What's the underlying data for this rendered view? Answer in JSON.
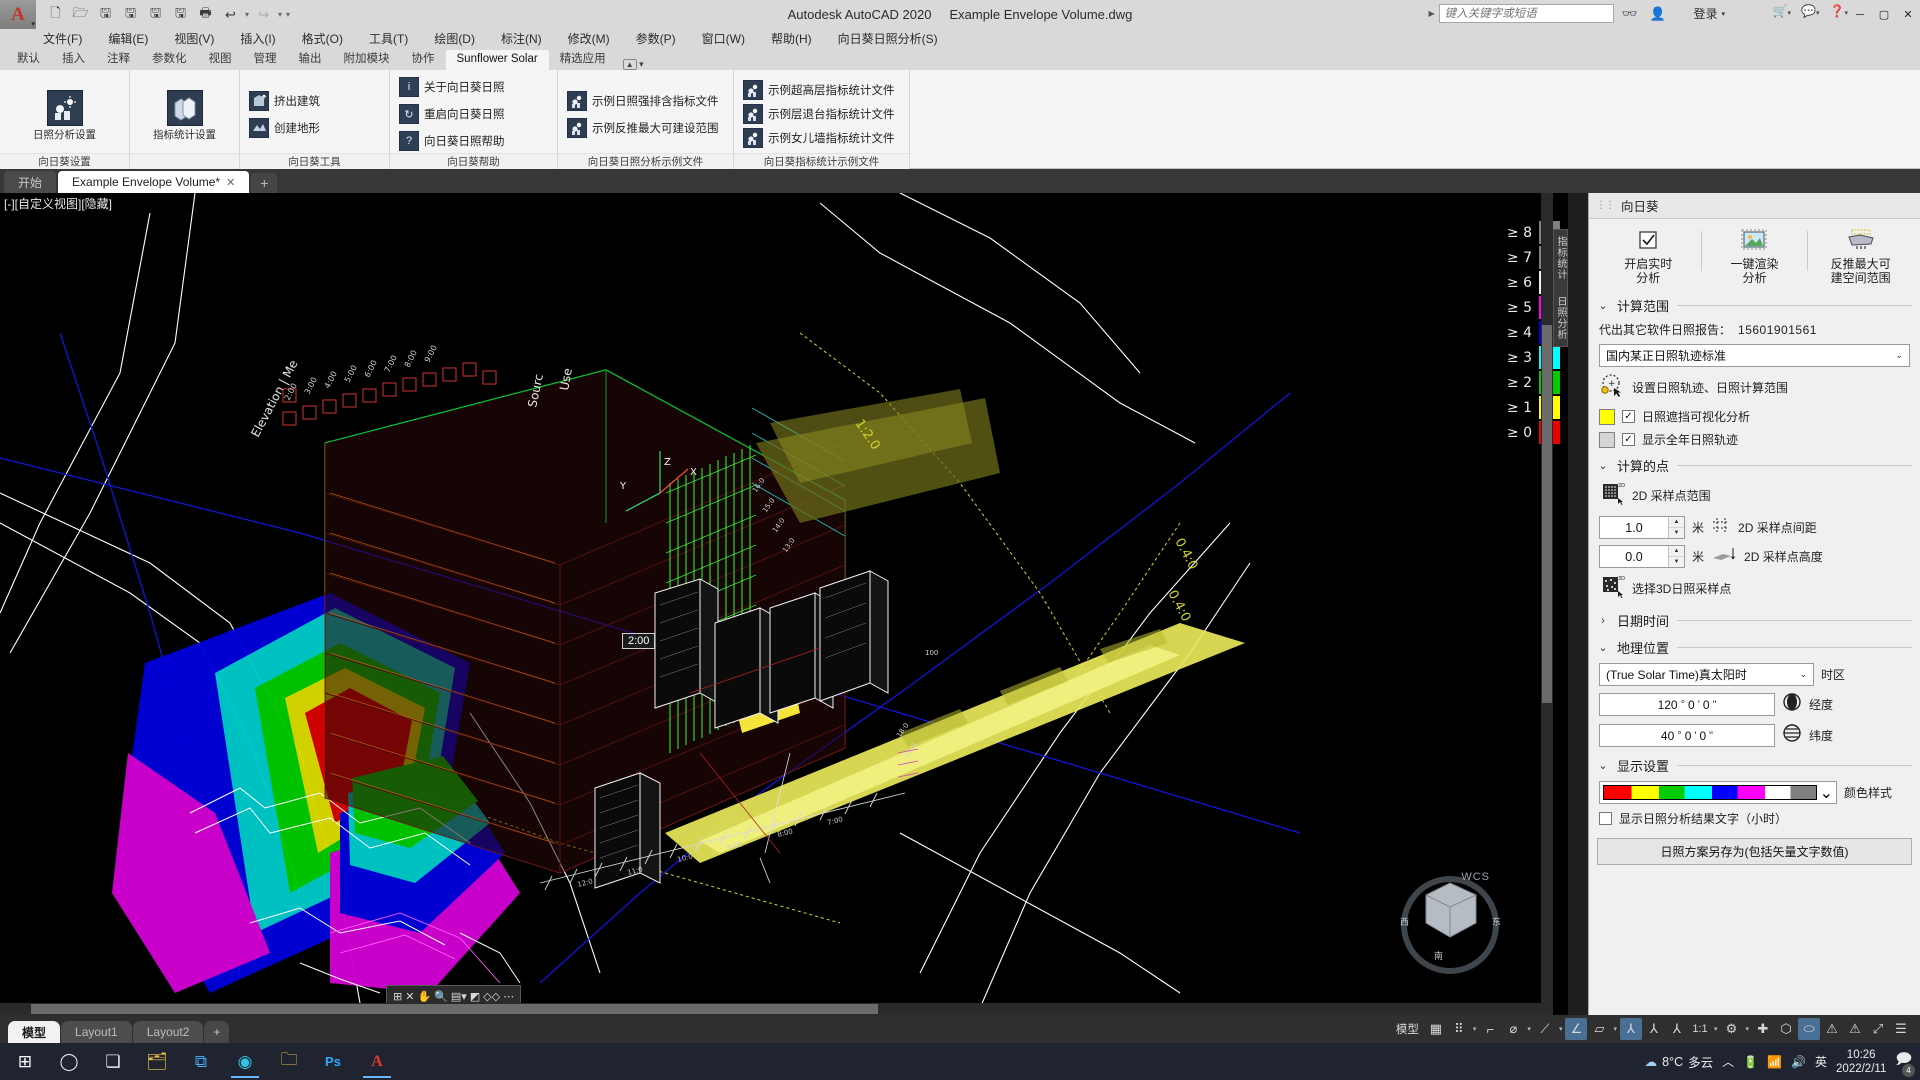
{
  "titlebar": {
    "app_title": "Autodesk AutoCAD 2020",
    "document_title": "Example Envelope Volume.dwg",
    "search_placeholder": "键入关键字或短语",
    "signin_label": "登录",
    "quick_access": [
      {
        "name": "new-icon",
        "glyph": "🗋"
      },
      {
        "name": "open-icon",
        "glyph": "🗁"
      },
      {
        "name": "save-icon",
        "glyph": "🖫"
      },
      {
        "name": "saveas-icon",
        "glyph": "🖫"
      },
      {
        "name": "export-icon",
        "glyph": "🖫"
      },
      {
        "name": "cloud-save-icon",
        "glyph": "🖫"
      },
      {
        "name": "plot-icon",
        "glyph": "🖶"
      },
      {
        "name": "undo-icon",
        "glyph": "↩"
      },
      {
        "name": "redo-icon",
        "glyph": "↪"
      }
    ],
    "window_controls": [
      "─",
      "▢",
      "✕"
    ]
  },
  "menubar": {
    "items": [
      "文件(F)",
      "编辑(E)",
      "视图(V)",
      "插入(I)",
      "格式(O)",
      "工具(T)",
      "绘图(D)",
      "标注(N)",
      "修改(M)",
      "参数(P)",
      "窗口(W)",
      "帮助(H)",
      "向日葵日照分析(S)"
    ]
  },
  "ribbon": {
    "tabs": [
      {
        "label": "默认",
        "active": false
      },
      {
        "label": "插入",
        "active": false
      },
      {
        "label": "注释",
        "active": false
      },
      {
        "label": "参数化",
        "active": false
      },
      {
        "label": "视图",
        "active": false
      },
      {
        "label": "管理",
        "active": false
      },
      {
        "label": "输出",
        "active": false
      },
      {
        "label": "附加模块",
        "active": false
      },
      {
        "label": "协作",
        "active": false
      },
      {
        "label": "Sunflower Solar",
        "active": true
      },
      {
        "label": "精选应用",
        "active": false
      }
    ],
    "panels": [
      {
        "title": "向日葵设置",
        "big_buttons": [
          {
            "label": "日照分析设置",
            "icon": "sun-analysis-settings-icon"
          },
          {
            "label": "指标统计设置",
            "icon": "metric-statistics-settings-icon"
          }
        ]
      },
      {
        "title": "向日葵工具",
        "mini_buttons": [
          {
            "label": "挤出建筑",
            "icon": "extrude-building-icon"
          },
          {
            "label": "创建地形",
            "icon": "create-terrain-icon"
          }
        ]
      },
      {
        "title": "向日葵帮助",
        "mini_buttons": [
          {
            "label": "关于向日葵日照",
            "icon": "info-icon"
          },
          {
            "label": "重启向日葵日照",
            "icon": "restart-icon"
          },
          {
            "label": "向日葵日照帮助",
            "icon": "help-icon"
          }
        ]
      },
      {
        "title": "向日葵日照分析示例文件",
        "mini_buttons": [
          {
            "label": "示例日照强排含指标文件",
            "icon": "sample-file-icon"
          },
          {
            "label": "示例反推最大可建设范围",
            "icon": "sample-file-icon"
          }
        ]
      },
      {
        "title": "向日葵指标统计示例文件",
        "mini_buttons": [
          {
            "label": "示例超高层指标统计文件",
            "icon": "sample-file-icon"
          },
          {
            "label": "示例层退台指标统计文件",
            "icon": "sample-file-icon"
          },
          {
            "label": "示例女儿墙指标统计文件",
            "icon": "sample-file-icon"
          }
        ]
      }
    ]
  },
  "filetabs": {
    "tabs": [
      {
        "label": "开始",
        "active": false,
        "closable": false
      },
      {
        "label": "Example Envelope Volume*",
        "active": true,
        "closable": true
      }
    ],
    "add_label": "+"
  },
  "canvas": {
    "viewport_label": "[-][自定义视图][隐藏]",
    "ucs_badge": "WCS",
    "time_tooltip": "2:00",
    "legend": [
      {
        "label": "≥ 8",
        "color": "#808080"
      },
      {
        "label": "≥ 7",
        "color": "#808080"
      },
      {
        "label": "≥ 6",
        "color": "#ededed"
      },
      {
        "label": "≥ 5",
        "color": "#ff00ff"
      },
      {
        "label": "≥ 4",
        "color": "#0000ee"
      },
      {
        "label": "≥ 3",
        "color": "#00ffff"
      },
      {
        "label": "≥ 2",
        "color": "#00cc00"
      },
      {
        "label": "≥ 1",
        "color": "#ffff00"
      },
      {
        "label": "≥ 0",
        "color": "#ee0000"
      }
    ],
    "edge_tabs": [
      "指标统计",
      "日照分析"
    ],
    "elevation_label": "Elevation | Me",
    "source_label": "Source",
    "user_label": "Use"
  },
  "sidepanel": {
    "header_title": "向日葵",
    "tools": [
      {
        "label": "开启实时\n分析",
        "label_line1": "开启实时",
        "label_line2": "分析",
        "icon": "checkbox-analysis-icon"
      },
      {
        "label": "一键渲染\n分析",
        "label_line1": "一键渲染",
        "label_line2": "分析",
        "icon": "render-image-icon"
      },
      {
        "label": "反推最大可\n建空间范围",
        "label_line1": "反推最大可",
        "label_line2": "建空间范围",
        "icon": "envelope-volume-icon"
      }
    ],
    "sections": {
      "calc_range": {
        "title": "计算范围",
        "expanded": true,
        "report_label": "代出其它软件日照报告：",
        "report_phone": "15601901561",
        "standard_select": "国内某正日照轨迹标准",
        "set_track_label": "设置日照轨迹、日照计算范围",
        "checkboxes": [
          {
            "label": "日照遮挡可视化分析",
            "checked": true,
            "swatch": "#ffff00"
          },
          {
            "label": "显示全年日照轨迹",
            "checked": true,
            "swatch": "#d4d4d4"
          }
        ]
      },
      "calc_points": {
        "title": "计算的点",
        "expanded": true,
        "range_2d_label": "2D 采样点范围",
        "spacing_value": "1.0",
        "spacing_unit": "米",
        "spacing_label": "2D 采样点间距",
        "height_value": "0.0",
        "height_unit": "米",
        "height_label": "2D 采样点高度",
        "select_3d_label": "选择3D日照采样点"
      },
      "date_time": {
        "title": "日期时间",
        "expanded": false
      },
      "geo_location": {
        "title": "地理位置",
        "expanded": true,
        "timezone_select": "(True Solar Time)真太阳时",
        "timezone_label": "时区",
        "longitude": {
          "deg": "120",
          "min": "0",
          "sec": "0",
          "label": "经度"
        },
        "latitude": {
          "deg": "40",
          "min": "0",
          "sec": "0",
          "label": "纬度"
        }
      },
      "display_settings": {
        "title": "显示设置",
        "expanded": true,
        "color_style_label": "颜色样式",
        "color_style_colors": [
          "#ff0000",
          "#ffff00",
          "#00cc00",
          "#00ffff",
          "#0000ff",
          "#ff00ff",
          "#ffffff",
          "#808080"
        ],
        "show_text_label": "显示日照分析结果文字（小时）",
        "show_text_checked": false,
        "save_button": "日照方案另存为(包括矢量文字数值)"
      }
    }
  },
  "statusbar": {
    "layout_tabs": [
      {
        "label": "模型",
        "active": true
      },
      {
        "label": "Layout1",
        "active": false
      },
      {
        "label": "Layout2",
        "active": false
      }
    ],
    "add_layout": "+",
    "model_label": "模型",
    "scale_label": "1:1",
    "items": [
      {
        "name": "grid-toggle",
        "glyph": "▦",
        "on": false
      },
      {
        "name": "snap-toggle",
        "glyph": "⠿",
        "on": false
      },
      {
        "name": "ortho-toggle",
        "glyph": "⌐",
        "on": false
      },
      {
        "name": "polar-tracking-toggle",
        "glyph": "⦜",
        "on": false
      },
      {
        "name": "osnap-toggle",
        "glyph": "⟋",
        "on": false
      },
      {
        "name": "otrack-toggle",
        "glyph": "∠",
        "on": true
      },
      {
        "name": "ucs-icon-toggle",
        "glyph": "▱",
        "on": false
      },
      {
        "name": "annotation-visibility-toggle",
        "glyph": "⅄",
        "on": true
      },
      {
        "name": "autoscale-toggle",
        "glyph": "⅄",
        "on": false
      },
      {
        "name": "annotation-scale",
        "glyph": "⅄",
        "on": false
      },
      {
        "name": "workspace-gear-icon",
        "glyph": "⚙",
        "on": false
      },
      {
        "name": "hardware-accel-icon",
        "glyph": "✚",
        "on": false
      },
      {
        "name": "isolate-objects-icon",
        "glyph": "⬡",
        "on": false
      },
      {
        "name": "graphics-performance-icon",
        "glyph": "⬭",
        "on": true
      },
      {
        "name": "clean-screen-icon",
        "glyph": "⤢",
        "on": false
      },
      {
        "name": "customization-icon",
        "glyph": "☰",
        "on": false
      }
    ]
  },
  "taskbar": {
    "start_icon": "windows-start-icon",
    "apps": [
      {
        "name": "start-button",
        "glyph": "⊞"
      },
      {
        "name": "search-icon",
        "glyph": "◯"
      },
      {
        "name": "task-view-icon",
        "glyph": "❏"
      },
      {
        "name": "file-explorer-icon",
        "glyph": "📁"
      },
      {
        "name": "vscode-icon",
        "glyph": "⧉"
      },
      {
        "name": "edge-browser-icon",
        "glyph": "◉"
      },
      {
        "name": "folder-icon",
        "glyph": "📂"
      },
      {
        "name": "photoshop-icon",
        "glyph": "Ps"
      },
      {
        "name": "autocad-icon",
        "glyph": "A"
      }
    ],
    "tray": {
      "weather_temp": "8°C",
      "weather_desc": "多云",
      "ime_label": "英",
      "time": "10:26",
      "date": "2022/2/11",
      "notification_count": "4"
    }
  }
}
